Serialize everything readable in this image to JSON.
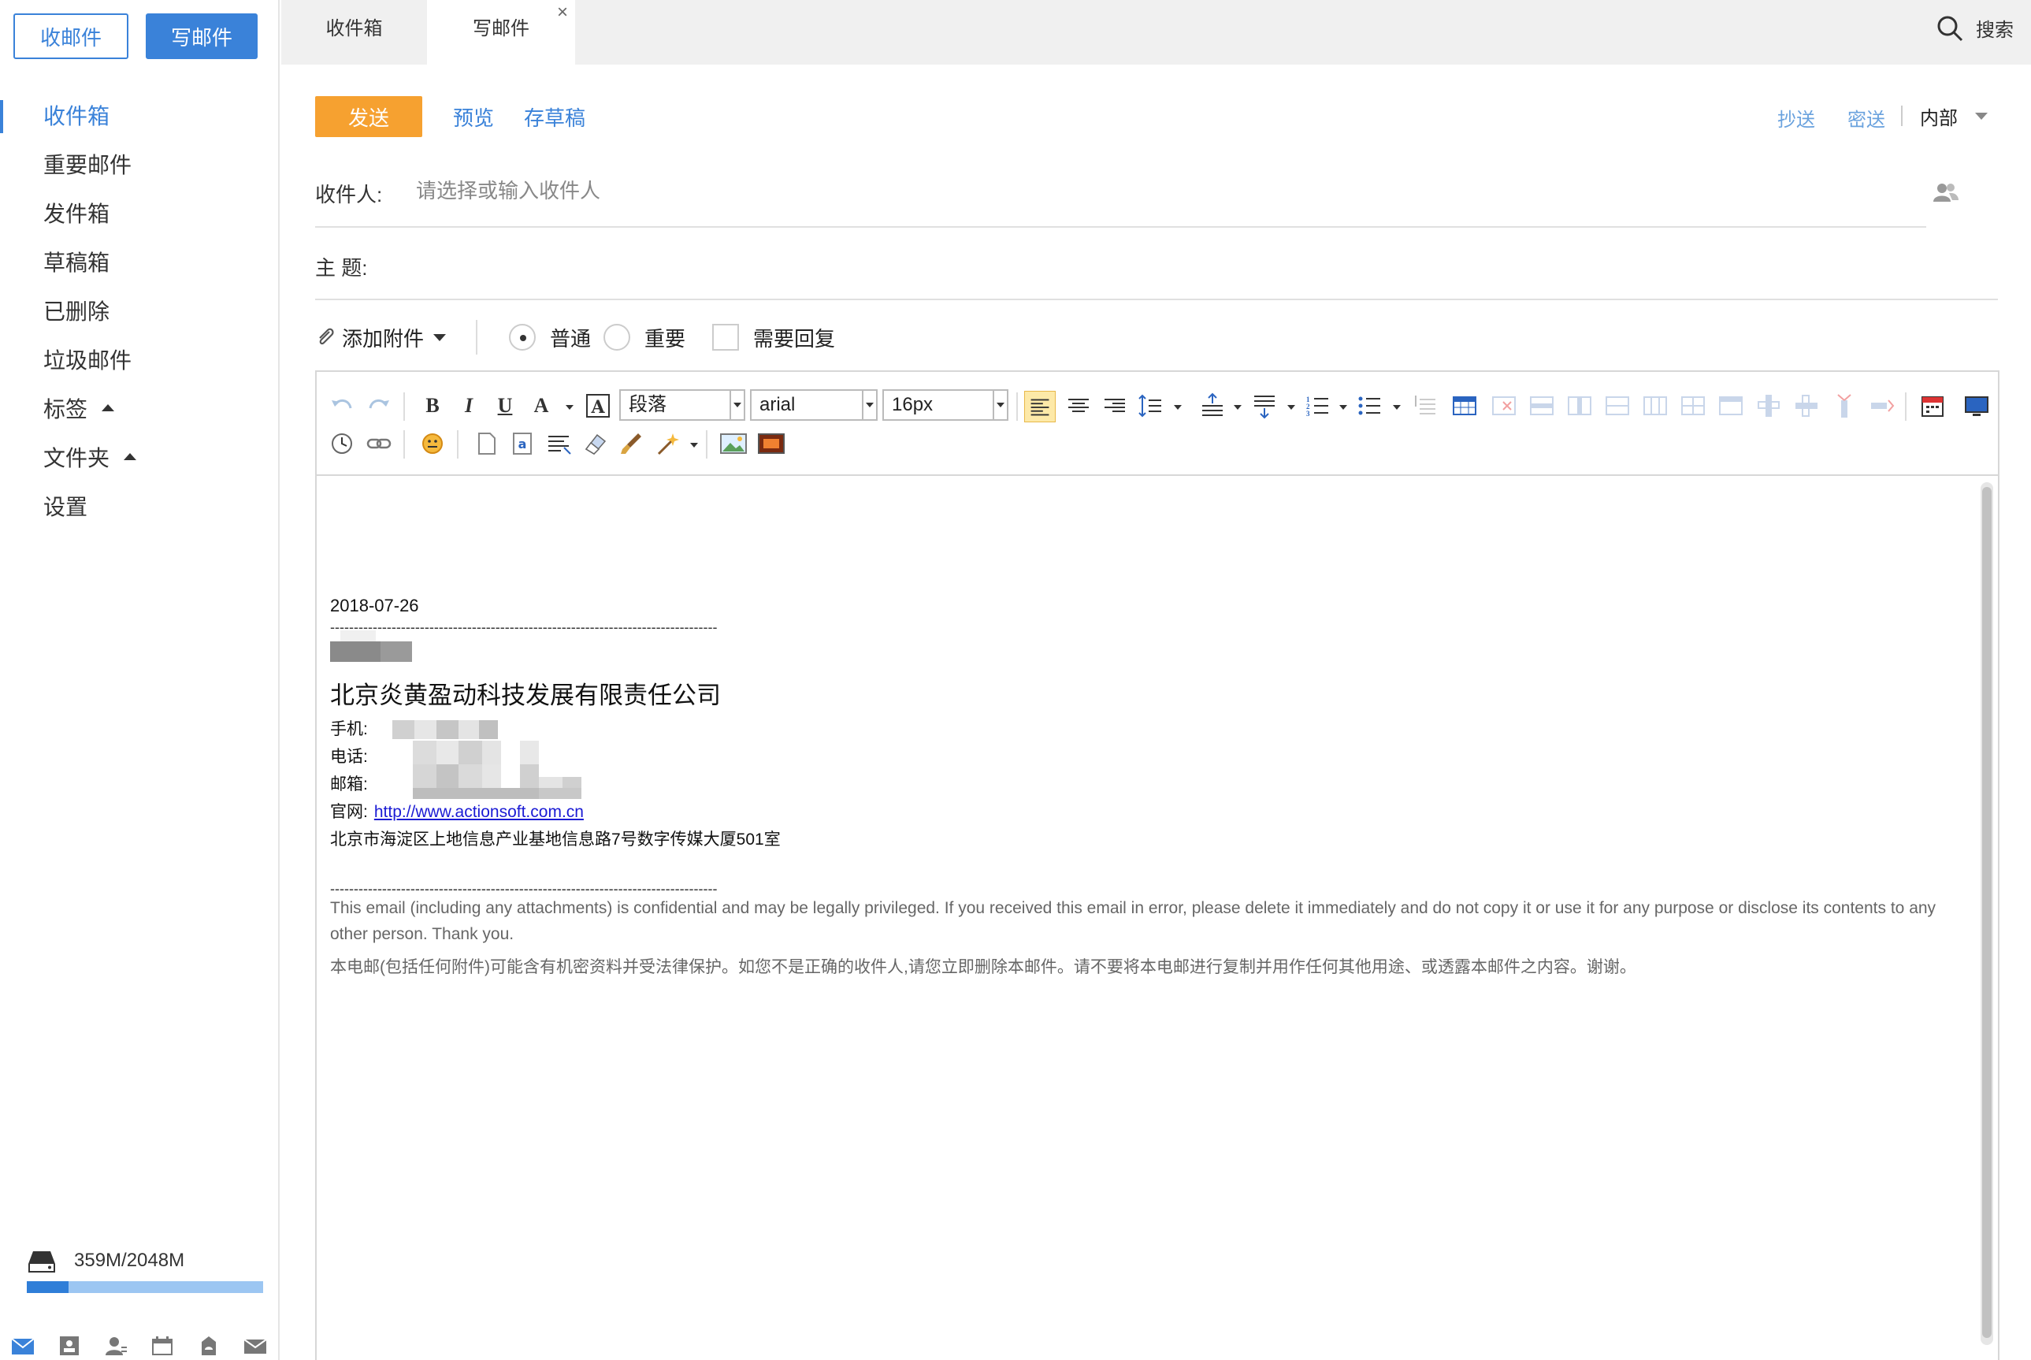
{
  "sidebar": {
    "inbox_button": "收邮件",
    "compose_button": "写邮件",
    "items": [
      {
        "label": "收件箱",
        "active": true
      },
      {
        "label": "重要邮件"
      },
      {
        "label": "发件箱"
      },
      {
        "label": "草稿箱"
      },
      {
        "label": "已删除"
      },
      {
        "label": "垃圾邮件"
      },
      {
        "label": "标签",
        "expandable": true
      },
      {
        "label": "文件夹",
        "expandable": true
      },
      {
        "label": "设置"
      }
    ],
    "storage": {
      "text": "359M/2048M",
      "used_fraction": 0.175
    },
    "bottom_icons": [
      "mail-icon",
      "contacts-card-icon",
      "person-icon",
      "calendar-icon",
      "cloud-disk-icon",
      "envelope-icon"
    ]
  },
  "tabs": {
    "items": [
      "收件箱",
      "写邮件"
    ],
    "close_glyph": "×",
    "search_label": "搜索"
  },
  "compose": {
    "send": "发送",
    "preview": "预览",
    "save_draft": "存草稿",
    "cc": "抄送",
    "bcc": "密送",
    "scope": "内部",
    "to_label": "收件人:",
    "to_placeholder": "请选择或输入收件人",
    "subject_label": "主  题:",
    "attach": "添加附件",
    "priority_normal": "普通",
    "priority_important": "重要",
    "need_reply": "需要回复"
  },
  "editor": {
    "paragraph": "段落",
    "font": "arial",
    "size": "16px",
    "toolbar_icons": [
      "undo-icon",
      "redo-icon",
      "bold-icon",
      "italic-icon",
      "underline-icon",
      "font-color-icon",
      "highlight-icon",
      "align-left-icon",
      "align-center-icon",
      "align-right-icon",
      "line-height-icon",
      "para-spacing-top-icon",
      "para-spacing-bottom-icon",
      "ordered-list-icon",
      "unordered-list-icon",
      "table-icon",
      "date-icon",
      "time-icon",
      "link-icon",
      "emoji-icon",
      "image-icon"
    ]
  },
  "content": {
    "date": "2018-07-26",
    "dash_line": "----------------------------------------------------------------------------------",
    "company": "北京炎黄盈动科技发展有限责任公司",
    "mobile_label": "手机:",
    "phone_label": "电话:",
    "email_label": "邮箱:",
    "site_label": "官网:",
    "site_url": "http://www.actionsoft.com.cn",
    "address": "北京市海淀区上地信息产业基地信息路7号数字传媒大厦501室",
    "disclaimer_en": "This email (including any attachments) is confidential and may be legally privileged. If you received this email in error, please delete it immediately and do not copy it or use it for any purpose or disclose its contents to any other person. Thank you.",
    "disclaimer_cn": "本电邮(包括任何附件)可能含有机密资料并受法律保护。如您不是正确的收件人,请您立即删除本邮件。请不要将本电邮进行复制并用作任何其他用途、或透露本邮件之内容。谢谢。"
  },
  "colors": {
    "primary": "#3a82d9",
    "send": "#f6a130",
    "link": "#1b1bd4"
  }
}
